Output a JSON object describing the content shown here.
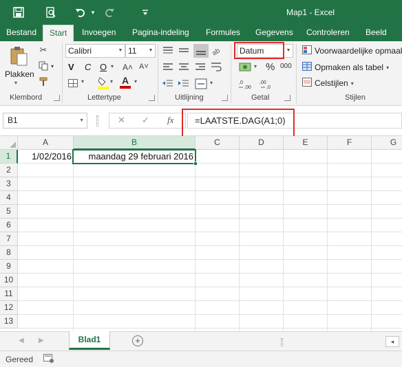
{
  "window": {
    "title": "Map1 - Excel",
    "accent_color": "#217346",
    "qat": [
      {
        "name": "save-icon",
        "glyph": "💾"
      },
      {
        "name": "print-preview-icon",
        "glyph": "⌕"
      },
      {
        "name": "undo-icon",
        "glyph": "↶"
      },
      {
        "name": "undo-dropdown-icon",
        "glyph": "▾"
      },
      {
        "name": "redo-icon",
        "glyph": "↷"
      },
      {
        "name": "customize-qat-icon",
        "glyph": "▾"
      }
    ]
  },
  "ribbon_tabs": [
    {
      "label": "Bestand",
      "active": false
    },
    {
      "label": "Start",
      "active": true
    },
    {
      "label": "Invoegen",
      "active": false
    },
    {
      "label": "Pagina-indeling",
      "active": false
    },
    {
      "label": "Formules",
      "active": false
    },
    {
      "label": "Gegevens",
      "active": false
    },
    {
      "label": "Controleren",
      "active": false
    },
    {
      "label": "Beeld",
      "active": false
    }
  ],
  "ribbon": {
    "clipboard": {
      "label": "Klembord",
      "paste_label": "Plakken",
      "paste_dropdown": "▾",
      "cut_icon": "✂",
      "copy_icon": "⧉",
      "format_painter_icon": "🖌"
    },
    "font": {
      "label": "Lettertype",
      "font_name": "Calibri",
      "font_size": "11",
      "grow_icon": "A˄",
      "shrink_icon": "A˅",
      "bold": "V",
      "italic": "C",
      "underline": "O",
      "borders_icon": "▦",
      "fill_icon": "▲",
      "font_color_icon": "A",
      "fill_color": "#ffff00",
      "font_color": "#d00000"
    },
    "alignment": {
      "label": "Uitlijning"
    },
    "number": {
      "label": "Getal",
      "format": "Datum",
      "currency_icon": "💶",
      "percent": "%",
      "thousands": "000",
      "inc_decimals": "←,0",
      "dec_decimals": ",00→"
    },
    "styles": {
      "label": "Stijlen",
      "items": [
        "Voorwaardelijke opmaak",
        "Opmaken als tabel",
        "Celstijlen"
      ]
    }
  },
  "formula_bar": {
    "name_box": "B1",
    "cancel_icon": "✕",
    "enter_icon": "✓",
    "fx_label": "fx",
    "formula": "=LAATSTE.DAG(A1;0)"
  },
  "sheet": {
    "columns": [
      "A",
      "B",
      "C",
      "D",
      "E",
      "F",
      "G"
    ],
    "selected_column": "B",
    "rows": [
      "1",
      "2",
      "3",
      "4",
      "5",
      "6",
      "7",
      "8",
      "9",
      "10",
      "11",
      "12",
      "13"
    ],
    "selected_row": "1",
    "cells": {
      "A1": "1/02/2016",
      "B1": "maandag 29 februari 2016"
    }
  },
  "sheet_tabs": {
    "tabs": [
      "Blad1"
    ],
    "active": "Blad1",
    "add_label": "+",
    "prev_icon": "◀",
    "next_icon": "▶",
    "scroll_left_icon": "◂"
  },
  "status_bar": {
    "status": "Gereed"
  }
}
